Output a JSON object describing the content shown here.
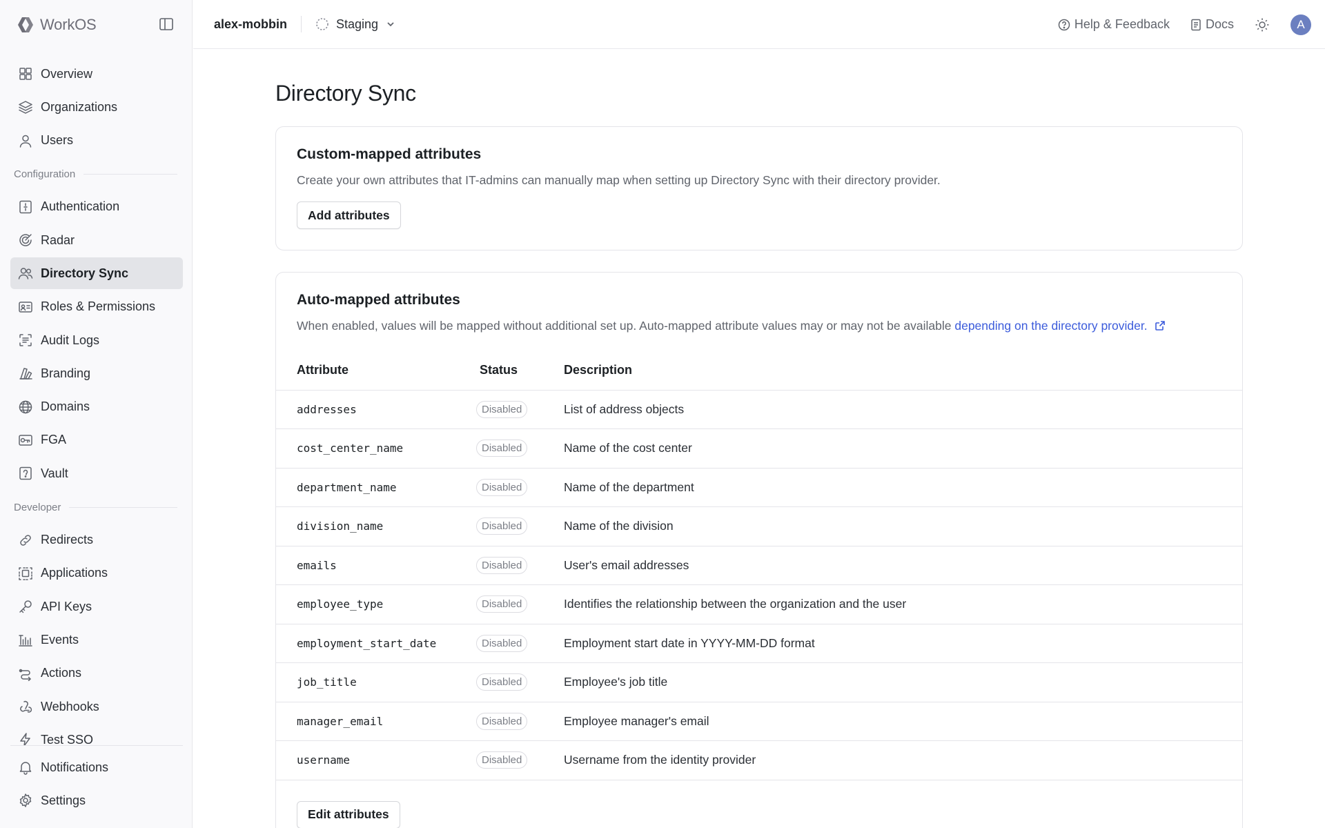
{
  "brand": {
    "name": "WorkOS"
  },
  "header": {
    "team": "alex-mobbin",
    "environment": "Staging",
    "help_label": "Help & Feedback",
    "docs_label": "Docs",
    "avatar_initial": "A"
  },
  "sidebar": {
    "items_top": [
      {
        "label": "Overview",
        "icon": "grid-icon"
      },
      {
        "label": "Organizations",
        "icon": "layers-icon"
      },
      {
        "label": "Users",
        "icon": "user-icon"
      }
    ],
    "section_configuration": "Configuration",
    "items_config": [
      {
        "label": "Authentication",
        "icon": "auth-icon"
      },
      {
        "label": "Radar",
        "icon": "radar-icon"
      },
      {
        "label": "Directory Sync",
        "icon": "users-icon",
        "active": true
      },
      {
        "label": "Roles & Permissions",
        "icon": "id-card-icon"
      },
      {
        "label": "Audit Logs",
        "icon": "audit-icon"
      },
      {
        "label": "Branding",
        "icon": "branding-icon"
      },
      {
        "label": "Domains",
        "icon": "globe-icon"
      },
      {
        "label": "FGA",
        "icon": "fga-icon"
      },
      {
        "label": "Vault",
        "icon": "vault-icon"
      }
    ],
    "section_developer": "Developer",
    "items_dev": [
      {
        "label": "Redirects",
        "icon": "link-icon"
      },
      {
        "label": "Applications",
        "icon": "applications-icon"
      },
      {
        "label": "API Keys",
        "icon": "key-icon"
      },
      {
        "label": "Events",
        "icon": "events-icon"
      },
      {
        "label": "Actions",
        "icon": "actions-icon"
      },
      {
        "label": "Webhooks",
        "icon": "webhook-icon"
      },
      {
        "label": "Test SSO",
        "icon": "bolt-icon"
      }
    ],
    "items_bottom": [
      {
        "label": "Notifications",
        "icon": "bell-icon"
      },
      {
        "label": "Settings",
        "icon": "gear-icon"
      }
    ]
  },
  "main": {
    "title": "Directory Sync",
    "custom": {
      "title": "Custom-mapped attributes",
      "description": "Create your own attributes that IT-admins can manually map when setting up Directory Sync with their directory provider.",
      "button": "Add attributes"
    },
    "auto": {
      "title": "Auto-mapped attributes",
      "description": "When enabled, values will be mapped without additional set up. Auto-mapped attribute values may or may not be available ",
      "link": "depending on the directory provider.",
      "columns": [
        "Attribute",
        "Status",
        "Description"
      ],
      "rows": [
        {
          "attribute": "addresses",
          "status": "Disabled",
          "description": "List of address objects"
        },
        {
          "attribute": "cost_center_name",
          "status": "Disabled",
          "description": "Name of the cost center"
        },
        {
          "attribute": "department_name",
          "status": "Disabled",
          "description": "Name of the department"
        },
        {
          "attribute": "division_name",
          "status": "Disabled",
          "description": "Name of the division"
        },
        {
          "attribute": "emails",
          "status": "Disabled",
          "description": "User's email addresses"
        },
        {
          "attribute": "employee_type",
          "status": "Disabled",
          "description": "Identifies the relationship between the organization and the user"
        },
        {
          "attribute": "employment_start_date",
          "status": "Disabled",
          "description": "Employment start date in YYYY-MM-DD format"
        },
        {
          "attribute": "job_title",
          "status": "Disabled",
          "description": "Employee's job title"
        },
        {
          "attribute": "manager_email",
          "status": "Disabled",
          "description": "Employee manager's email"
        },
        {
          "attribute": "username",
          "status": "Disabled",
          "description": "Username from the identity provider"
        }
      ],
      "button": "Edit attributes"
    }
  }
}
